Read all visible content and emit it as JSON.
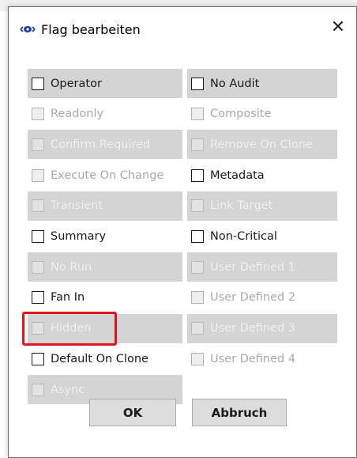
{
  "window": {
    "title": "Flag bearbeiten",
    "close_glyph": "✕"
  },
  "flags": {
    "left": [
      {
        "label": "Operator",
        "enabled": true,
        "shaded": true
      },
      {
        "label": "Readonly",
        "enabled": false,
        "shaded": false
      },
      {
        "label": "Confirm Required",
        "enabled": false,
        "shaded": true
      },
      {
        "label": "Execute On Change",
        "enabled": false,
        "shaded": false
      },
      {
        "label": "Transient",
        "enabled": false,
        "shaded": true
      },
      {
        "label": "Summary",
        "enabled": true,
        "shaded": false
      },
      {
        "label": "No Run",
        "enabled": false,
        "shaded": true
      },
      {
        "label": "Fan In",
        "enabled": true,
        "shaded": false
      },
      {
        "label": "Hidden",
        "enabled": false,
        "shaded": true,
        "highlighted": true
      },
      {
        "label": "Default On Clone",
        "enabled": true,
        "shaded": false
      },
      {
        "label": "Async",
        "enabled": false,
        "shaded": true
      }
    ],
    "right": [
      {
        "label": "No Audit",
        "enabled": true,
        "shaded": true
      },
      {
        "label": "Composite",
        "enabled": false,
        "shaded": false
      },
      {
        "label": "Remove On Clone",
        "enabled": false,
        "shaded": true
      },
      {
        "label": "Metadata",
        "enabled": true,
        "shaded": false
      },
      {
        "label": "Link Target",
        "enabled": false,
        "shaded": true
      },
      {
        "label": "Non-Critical",
        "enabled": true,
        "shaded": false
      },
      {
        "label": "User Defined 1",
        "enabled": false,
        "shaded": true
      },
      {
        "label": "User Defined 2",
        "enabled": false,
        "shaded": false
      },
      {
        "label": "User Defined 3",
        "enabled": false,
        "shaded": true
      },
      {
        "label": "User Defined 4",
        "enabled": false,
        "shaded": false
      }
    ]
  },
  "buttons": {
    "ok_label": "OK",
    "cancel_label": "Abbruch"
  },
  "colors": {
    "highlight": "#e0161c",
    "shade": "#d4d4d4",
    "icon_blue": "#1c3f9c"
  },
  "icons": {
    "app": "flag-eye-icon",
    "close": "close-icon"
  }
}
